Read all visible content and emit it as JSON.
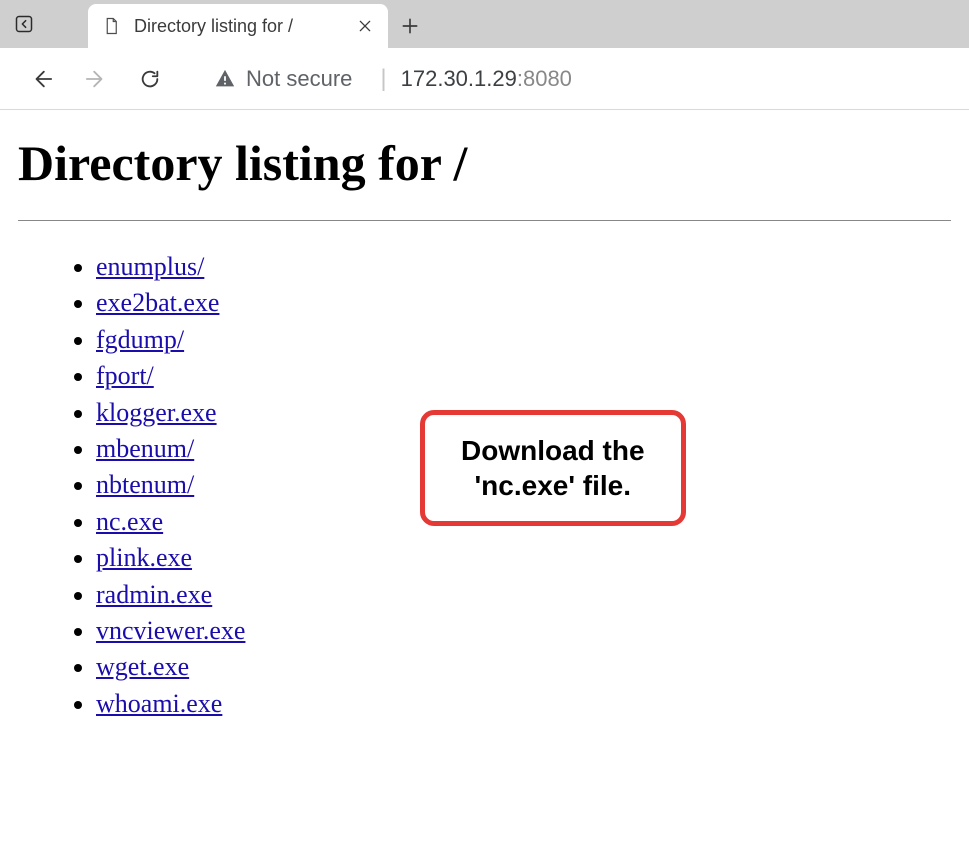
{
  "browser": {
    "tab": {
      "title": "Directory listing for /"
    },
    "address": {
      "security_label": "Not secure",
      "divider": "|",
      "host": "172.30.1.29",
      "port": ":8080"
    }
  },
  "page": {
    "heading": "Directory listing for /",
    "entries": [
      "enumplus/",
      "exe2bat.exe",
      "fgdump/",
      "fport/",
      "klogger.exe",
      "mbenum/",
      "nbtenum/",
      "nc.exe",
      "plink.exe",
      "radmin.exe",
      "vncviewer.exe",
      "wget.exe",
      "whoami.exe"
    ]
  },
  "callout": {
    "line1": "Download the",
    "line2": "'nc.exe' file."
  }
}
